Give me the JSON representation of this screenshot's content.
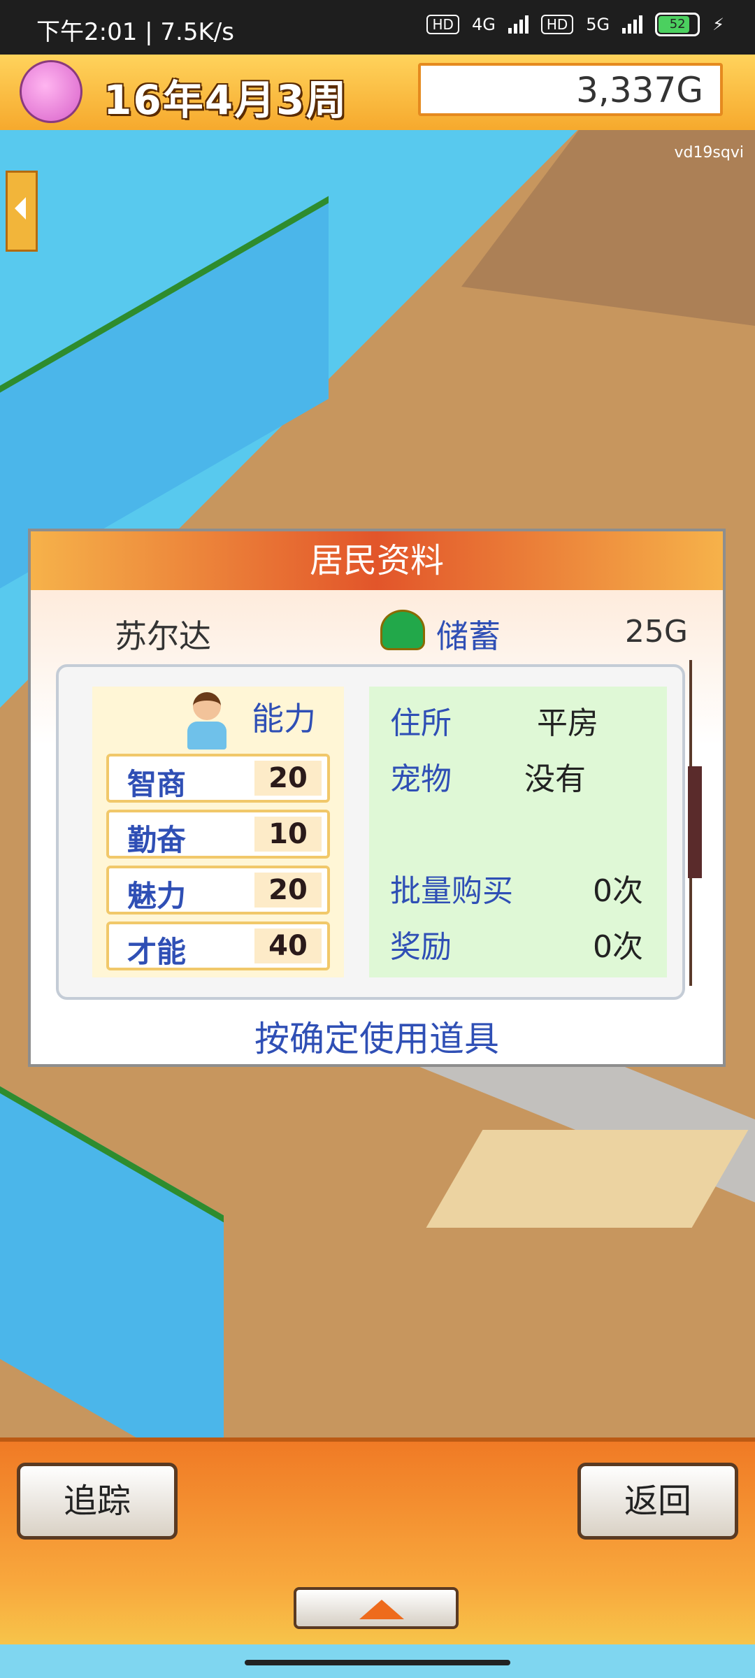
{
  "status_bar": {
    "time": "下午2:01 | 7.5K/s",
    "net_tags": [
      "HD",
      "4G",
      "HD",
      "5G"
    ],
    "battery": "52"
  },
  "top_bar": {
    "date": "16年4月3周",
    "money": "3,337G",
    "watermark": "vd19sqvi"
  },
  "dialog": {
    "title": "居民资料",
    "resident_name": "苏尔达",
    "savings_label": "储蓄",
    "savings_value": "25G",
    "ability_title": "能力",
    "stats": [
      {
        "label": "智商",
        "value": "20"
      },
      {
        "label": "勤奋",
        "value": "10"
      },
      {
        "label": "魅力",
        "value": "20"
      },
      {
        "label": "才能",
        "value": "40"
      }
    ],
    "info": {
      "residence_label": "住所",
      "residence_value": "平房",
      "pet_label": "宠物",
      "pet_value": "没有",
      "bulk_label": "批量购买",
      "bulk_value": "0次",
      "reward_label": "奖励",
      "reward_value": "0次"
    },
    "hint": "按确定使用道具"
  },
  "buttons": {
    "track": "追踪",
    "back": "返回"
  }
}
